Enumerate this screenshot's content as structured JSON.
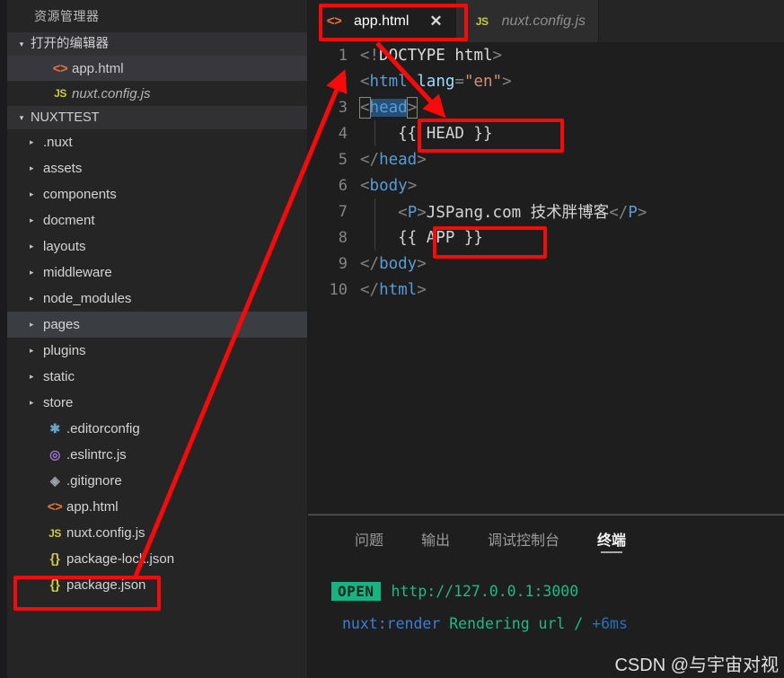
{
  "sidebar": {
    "title": "资源管理器",
    "open_editors": {
      "label": "打开的编辑器",
      "twisty": "▾",
      "items": [
        {
          "name": "app.html",
          "icon": "html-icon",
          "icon_glyph": "<>",
          "active": true,
          "italic": false
        },
        {
          "name": "nuxt.config.js",
          "icon": "js-icon",
          "icon_glyph": "JS",
          "active": false,
          "italic": true
        }
      ]
    },
    "project": {
      "label": "NUXTTEST",
      "twisty": "▾",
      "folders": [
        {
          "name": ".nuxt",
          "arrow": "▸"
        },
        {
          "name": "assets",
          "arrow": "▸"
        },
        {
          "name": "components",
          "arrow": "▸"
        },
        {
          "name": "docment",
          "arrow": "▸"
        },
        {
          "name": "layouts",
          "arrow": "▸"
        },
        {
          "name": "middleware",
          "arrow": "▸"
        },
        {
          "name": "node_modules",
          "arrow": "▸"
        },
        {
          "name": "pages",
          "arrow": "▸",
          "selected": true
        },
        {
          "name": "plugins",
          "arrow": "▸"
        },
        {
          "name": "static",
          "arrow": "▸"
        },
        {
          "name": "store",
          "arrow": "▸"
        }
      ],
      "files": [
        {
          "name": ".editorconfig",
          "icon": "gear-icon",
          "icon_glyph": "✱",
          "icon_class": "ic-gear"
        },
        {
          "name": ".eslintrc.js",
          "icon": "eslint-icon",
          "icon_glyph": "◎",
          "icon_class": "ic-eslint"
        },
        {
          "name": ".gitignore",
          "icon": "git-icon",
          "icon_glyph": "◈",
          "icon_class": "ic-git"
        },
        {
          "name": "app.html",
          "icon": "html-icon",
          "icon_glyph": "<>",
          "icon_class": "ic-html",
          "highlighted": true
        },
        {
          "name": "nuxt.config.js",
          "icon": "js-icon",
          "icon_glyph": "JS",
          "icon_class": "ic-js"
        },
        {
          "name": "package-lock.json",
          "icon": "json-icon",
          "icon_glyph": "{}",
          "icon_class": "ic-json"
        },
        {
          "name": "package.json",
          "icon": "json-icon",
          "icon_glyph": "{}",
          "icon_class": "ic-json"
        }
      ]
    }
  },
  "tabs": [
    {
      "label": "app.html",
      "icon_glyph": "<>",
      "icon": "html-icon",
      "close": "✕",
      "active": true,
      "italic": false
    },
    {
      "label": "nuxt.config.js",
      "icon_glyph": "JS",
      "icon": "js-icon",
      "active": false,
      "italic": true
    }
  ],
  "editor": {
    "line_numbers": [
      "1",
      "2",
      "3",
      "4",
      "5",
      "6",
      "7",
      "8",
      "9",
      "10"
    ],
    "lines": [
      {
        "n": "1",
        "tokens": [
          {
            "t": "<!",
            "c": "c-punct"
          },
          {
            "t": "DOCTYPE",
            "c": "c-doctype"
          },
          {
            "t": " html",
            "c": "c-doctype"
          },
          {
            "t": ">",
            "c": "c-punct"
          }
        ]
      },
      {
        "n": "2",
        "tokens": [
          {
            "t": "<",
            "c": "c-punct"
          },
          {
            "t": "html",
            "c": "c-tag"
          },
          {
            "t": " ",
            "c": "c-plain"
          },
          {
            "t": "lang",
            "c": "c-attr"
          },
          {
            "t": "=",
            "c": "c-punct"
          },
          {
            "t": "\"en\"",
            "c": "c-str"
          },
          {
            "t": ">",
            "c": "c-punct"
          }
        ]
      },
      {
        "n": "3",
        "tokens": [
          {
            "t": "<",
            "c": "c-punct"
          },
          {
            "t": "head",
            "c": "c-tag"
          },
          {
            "t": ">",
            "c": "c-punct"
          }
        ]
      },
      {
        "n": "4",
        "tokens": [
          {
            "t": "    {{ HEAD }}",
            "c": "c-mus"
          }
        ]
      },
      {
        "n": "5",
        "tokens": [
          {
            "t": "</",
            "c": "c-punct"
          },
          {
            "t": "head",
            "c": "c-tag"
          },
          {
            "t": ">",
            "c": "c-punct"
          }
        ]
      },
      {
        "n": "6",
        "tokens": [
          {
            "t": "<",
            "c": "c-punct"
          },
          {
            "t": "body",
            "c": "c-tag"
          },
          {
            "t": ">",
            "c": "c-punct"
          }
        ]
      },
      {
        "n": "7",
        "tokens": [
          {
            "t": "    <",
            "c": "c-punct"
          },
          {
            "t": "P",
            "c": "c-tag"
          },
          {
            "t": ">",
            "c": "c-punct"
          },
          {
            "t": "JSPang.com 技术胖博客",
            "c": "c-plain"
          },
          {
            "t": "</",
            "c": "c-punct"
          },
          {
            "t": "P",
            "c": "c-tag"
          },
          {
            "t": ">",
            "c": "c-punct"
          }
        ]
      },
      {
        "n": "8",
        "tokens": [
          {
            "t": "    {{ APP }}",
            "c": "c-mus"
          }
        ]
      },
      {
        "n": "9",
        "tokens": [
          {
            "t": "</",
            "c": "c-punct"
          },
          {
            "t": "body",
            "c": "c-tag"
          },
          {
            "t": ">",
            "c": "c-punct"
          }
        ]
      },
      {
        "n": "10",
        "tokens": [
          {
            "t": "</",
            "c": "c-punct"
          },
          {
            "t": "html",
            "c": "c-tag"
          },
          {
            "t": ">",
            "c": "c-punct"
          }
        ]
      }
    ]
  },
  "panel": {
    "tabs": [
      {
        "label": "问题",
        "active": false
      },
      {
        "label": "输出",
        "active": false
      },
      {
        "label": "调试控制台",
        "active": false
      },
      {
        "label": "终端",
        "active": true
      }
    ],
    "terminal": {
      "badge": "OPEN",
      "url": "http://127.0.0.1:3000",
      "log_prefix": "nuxt:render",
      "log_message": "Rendering url /",
      "log_timing": "+6ms"
    }
  },
  "watermark": "CSDN @与宇宙对视",
  "annotation_color": "#f60a0a"
}
